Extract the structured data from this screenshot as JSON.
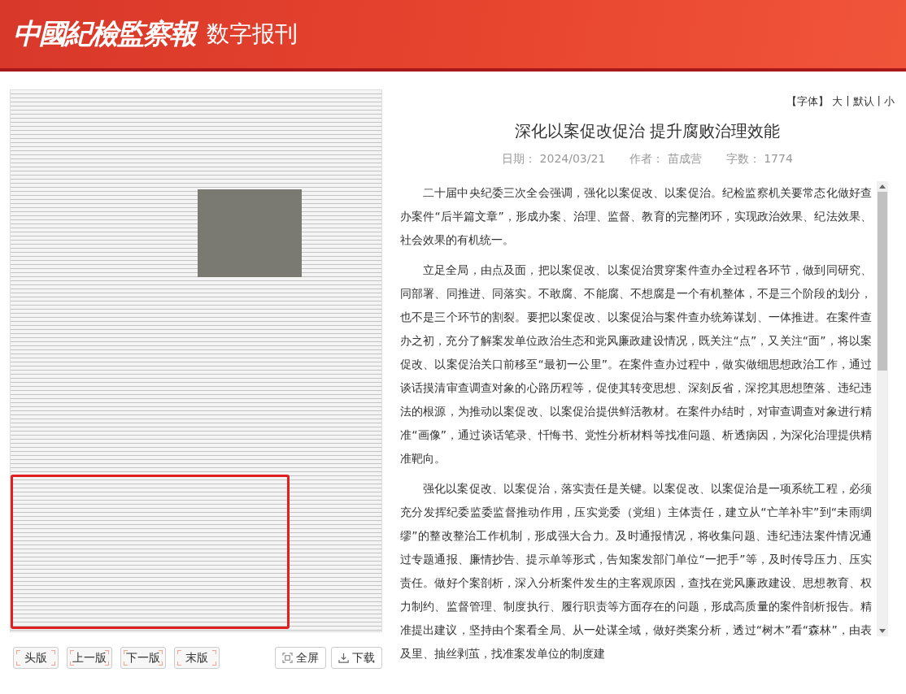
{
  "header": {
    "logo": "中國紀檢監察報",
    "subtitle": "数字报刊"
  },
  "newspaper": {
    "highlighted_area": true
  },
  "page_nav": [
    {
      "label": "头版"
    },
    {
      "label": "上一版"
    },
    {
      "label": "下一版"
    },
    {
      "label": "末版"
    }
  ],
  "tools": [
    {
      "kind": "fullscreen",
      "label": "全屏"
    },
    {
      "kind": "download",
      "label": "下载"
    }
  ],
  "font_size": {
    "label": "【字体】",
    "separator": "|",
    "options": [
      "大",
      "默认",
      "小"
    ]
  },
  "article": {
    "title": "深化以案促改促治 提升腐败治理效能",
    "meta": [
      {
        "label": "日期：",
        "value": "2024/03/21"
      },
      {
        "label": "作者：",
        "value": "苗成营"
      },
      {
        "label": "字数：",
        "value": "1774"
      }
    ],
    "paragraphs": [
      "二十届中央纪委三次全会强调，强化以案促改、以案促治。纪检监察机关要常态化做好查办案件“后半篇文章”，形成办案、治理、监督、教育的完整闭环，实现政治效果、纪法效果、社会效果的有机统一。",
      "立足全局，由点及面，把以案促改、以案促治贯穿案件查办全过程各环节，做到同研究、同部署、同推进、同落实。不敢腐、不能腐、不想腐是一个有机整体，不是三个阶段的划分，也不是三个环节的割裂。要把以案促改、以案促治与案件查办统筹谋划、一体推进。在案件查办之初，充分了解案发单位政治生态和党风廉政建设情况，既关注“点”，又关注“面”，将以案促改、以案促治关口前移至“最初一公里”。在案件查办过程中，做实做细思想政治工作，通过谈话摸清审查调查对象的心路历程等，促使其转变思想、深刻反省，深挖其思想堕落、违纪违法的根源，为推动以案促改、以案促治提供鲜活教材。在案件办结时，对审查调查对象进行精准“画像”，通过谈话笔录、忏悔书、党性分析材料等找准问题、析透病因，为深化治理提供精准靶向。",
      "强化以案促改、以案促治，落实责任是关键。以案促改、以案促治是一项系统工程，必须充分发挥纪委监委监督推动作用，压实党委（党组）主体责任，建立从“亡羊补牢”到“未雨绸缪”的整改整治工作机制，形成强大合力。及时通报情况，将收集问题、违纪违法案件情况通过专题通报、廉情抄告、提示单等形式，告知案发部门单位“一把手”等，及时传导压力、压实责任。做好个案剖析，深入分析案件发生的主客观原因，查找在党风廉政建设、思想教育、权力制约、监督管理、制度执行、履行职责等方面存在的问题，形成高质量的案件剖析报告。精准提出建议，坚持由个案看全局、从一处谋全域，做好类案分析，透过“树木”看“森林”，由表及里、抽丝剥茧，找准案发单位的制度建"
    ]
  }
}
